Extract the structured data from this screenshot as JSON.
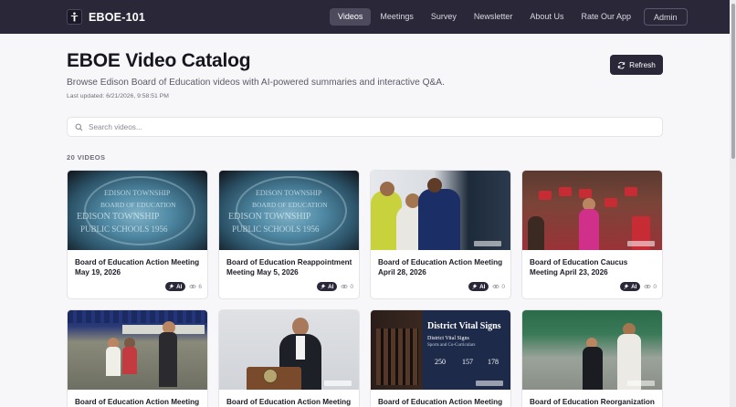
{
  "header": {
    "brand": "EBOE-101",
    "nav": [
      {
        "label": "Videos",
        "active": true
      },
      {
        "label": "Meetings",
        "active": false
      },
      {
        "label": "Survey",
        "active": false
      },
      {
        "label": "Newsletter",
        "active": false
      },
      {
        "label": "About Us",
        "active": false
      },
      {
        "label": "Rate Our App",
        "active": false
      }
    ],
    "admin_label": "Admin"
  },
  "page": {
    "title": "EBOE Video Catalog",
    "subtitle": "Browse Edison Board of Education videos with AI-powered summaries and interactive Q&A.",
    "last_updated": "Last updated: 6/21/2026, 9:58:51 PM",
    "refresh_label": "Refresh"
  },
  "search": {
    "placeholder": "Search videos..."
  },
  "count_label": "20 VIDEOS",
  "videos": [
    {
      "title": "Board of Education Action Meeting May 19, 2026",
      "ai": "AI",
      "views": "6"
    },
    {
      "title": "Board of Education Reappointment Meeting May 5, 2026",
      "ai": "AI",
      "views": "0"
    },
    {
      "title": "Board of Education Action Meeting April 28, 2026",
      "ai": "AI",
      "views": "0"
    },
    {
      "title": "Board of Education Caucus Meeting April 23, 2026",
      "ai": "AI",
      "views": "0"
    },
    {
      "title": "Board of Education Action Meeting"
    },
    {
      "title": "Board of Education Action Meeting"
    },
    {
      "title": "Board of Education Action Meeting"
    },
    {
      "title": "Board of Education Reorganization"
    }
  ],
  "thumbs": {
    "seal_line1": "EDISON TOWNSHIP",
    "seal_line2": "BOARD OF EDUCATION",
    "seal_line3": "EDISON TOWNSHIP",
    "seal_line4": "PUBLIC SCHOOLS 1956",
    "dv_title": "District Vital Signs",
    "dv_sub": "District Vital Signs",
    "dv_sub2": "Sports and Co-Curriculars",
    "dv_num1": "250",
    "dv_num2": "157",
    "dv_num3": "178"
  },
  "colors": {
    "header": "#2a2838",
    "accent": "#2a2838",
    "background": "#f7f7f9"
  }
}
